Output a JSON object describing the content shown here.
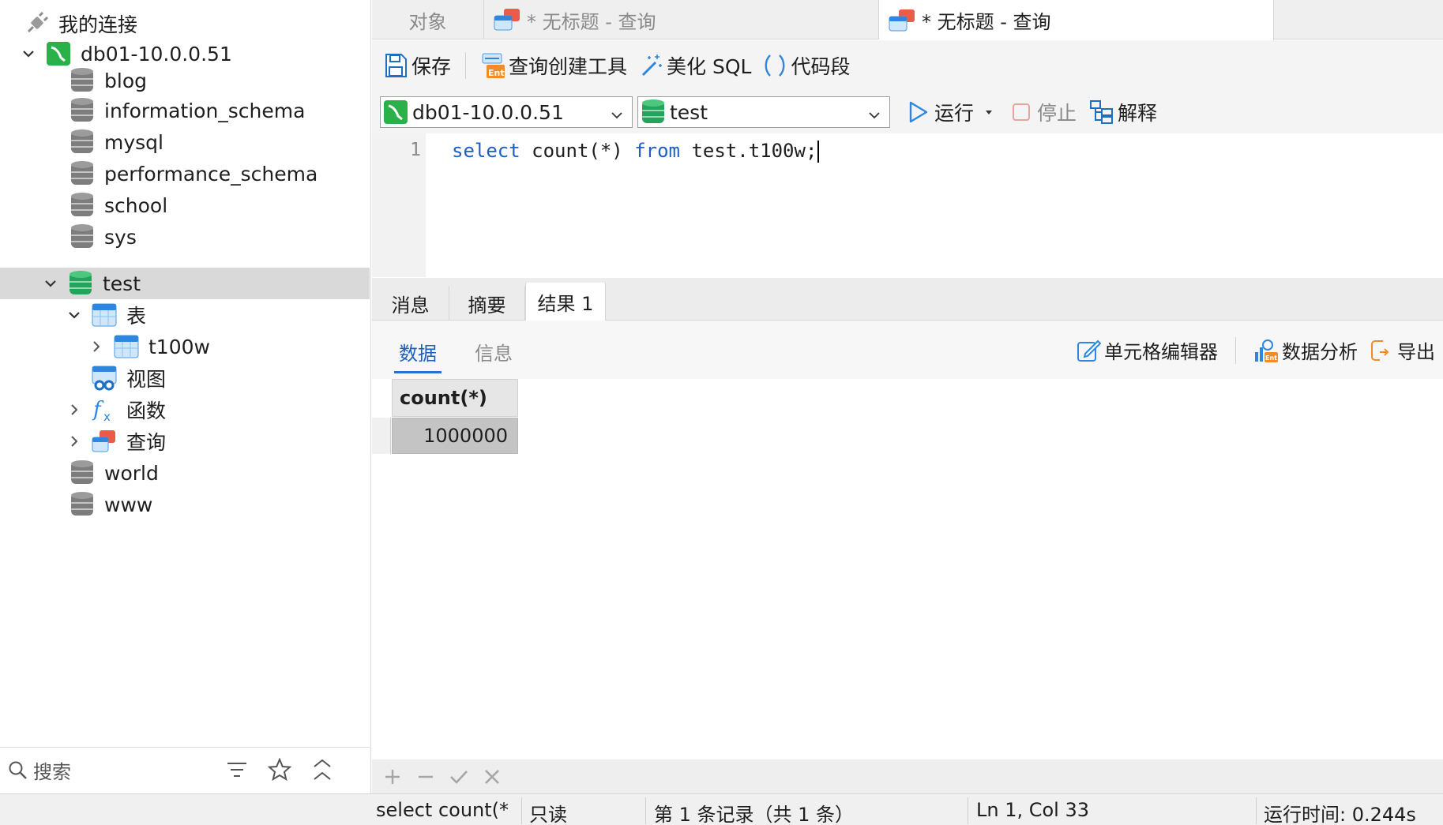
{
  "sidebar": {
    "header": "我的连接",
    "connection": "db01-10.0.0.51",
    "databases": {
      "blog": "blog",
      "information_schema": "information_schema",
      "mysql": "mysql",
      "performance_schema": "performance_schema",
      "school": "school",
      "sys": "sys",
      "test": "test",
      "world": "world",
      "www": "www"
    },
    "test_children": {
      "tables": "表",
      "table_t100w": "t100w",
      "views": "视图",
      "functions": "函数",
      "queries": "查询"
    },
    "search_label": "搜索"
  },
  "tabs": {
    "objects": "对象",
    "query1": "* 无标题 - 查询",
    "query2": "* 无标题 - 查询"
  },
  "toolbar": {
    "save": "保存",
    "query_builder": "查询创建工具",
    "beautify": "美化 SQL",
    "snippet": "代码段",
    "run": "运行",
    "stop": "停止",
    "explain": "解释"
  },
  "selectors": {
    "connection": "db01-10.0.0.51",
    "database": "test"
  },
  "editor": {
    "line_number": "1",
    "tokens": {
      "kw_select": "select",
      "t1": " count(*) ",
      "kw_from": "from",
      "t2": " test.t100w;"
    }
  },
  "result_tabs": {
    "messages": "消息",
    "summary": "摘要",
    "result1": "结果 1"
  },
  "result_subtabs": {
    "data": "数据",
    "info": "信息"
  },
  "result_actions": {
    "cell_editor": "单元格编辑器",
    "data_analysis": "数据分析",
    "export": "导出"
  },
  "grid": {
    "column": "count(*)",
    "value": "1000000"
  },
  "status": {
    "query": "select count(*",
    "mode": "只读",
    "records": "第 1 条记录（共 1 条）",
    "position": "Ln 1, Col 33",
    "elapsed": "运行时间: 0.244s"
  },
  "colors": {
    "accent_blue": "#1f5fbf",
    "mysql_green": "#2bb14a",
    "db_gray": "#7d7d7d",
    "db_active_green": "#22a55a",
    "selected_row": "#d9d9d9"
  }
}
